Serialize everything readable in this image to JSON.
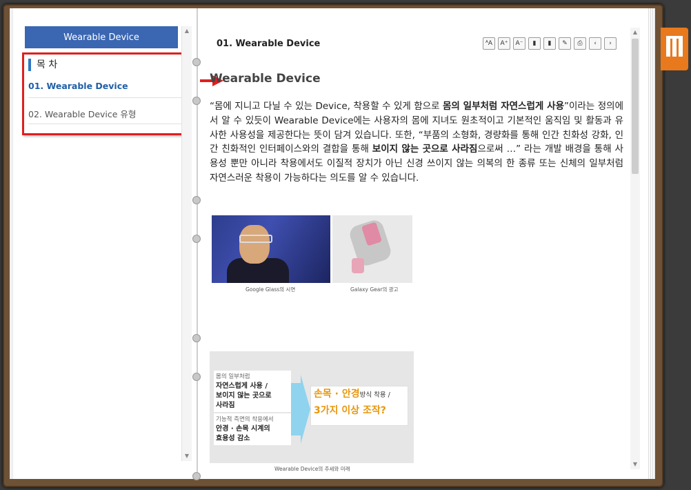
{
  "sidebar": {
    "header": "Wearable Device",
    "toc_title": "목 차",
    "items": [
      {
        "label": "01. Wearable Device"
      },
      {
        "label": "02. Wearable Device 유형"
      }
    ]
  },
  "content": {
    "chapter_title": "01. Wearable Device",
    "toolbar": [
      {
        "icon": "font-size-reset-icon",
        "glyph": "ᴬA"
      },
      {
        "icon": "font-size-increase-icon",
        "glyph": "A⁺"
      },
      {
        "icon": "font-size-decrease-icon",
        "glyph": "A⁻"
      },
      {
        "icon": "bookmark-icon",
        "glyph": "▮"
      },
      {
        "icon": "bookmark-list-icon",
        "glyph": "▮"
      },
      {
        "icon": "memo-icon",
        "glyph": "✎"
      },
      {
        "icon": "print-icon",
        "glyph": "⎙"
      },
      {
        "icon": "prev-page-icon",
        "glyph": "‹"
      },
      {
        "icon": "next-page-icon",
        "glyph": "›"
      }
    ],
    "heading": "Wearable Device",
    "paragraph": {
      "p1": "“몸에 지니고 다닐 수 있는 Device, 착용할 수 있게 함으로 ",
      "b1": "몸의 일부처럼 자연스럽게 사용",
      "p2": "”이라는 정의에서 알 수 있듯이 Wearable Device에는 사용자의 몸에 지녀도 원초적이고 기본적인 움직임 및 활동과 유사한 사용성을 제공한다는 뜻이 담겨 있습니다. 또한, “부품의 소형화, 경량화를 통해 인간 친화성 강화, 인간 친화적인 인터페이스와의 결합을 통해 ",
      "b2": "보이지 않는 곳으로 사라짐",
      "p3": "으로써 …” 라는 개발 배경을 통해 사용성 뿐만 아니라 착용에서도 이질적 장치가 아닌 신경 쓰이지 않는 의복의 한 종류 또는 신체의 일부처럼 자연스러운 착용이 가능하다는 의도를 알 수 있습니다."
    },
    "captions": {
      "img1": "Google Glass의 시연",
      "img2": "Galaxy Gear의 광고",
      "img3": "Wearable Device의 추세와 미래"
    },
    "diagram": {
      "box1_small": "몸의 일부처럼",
      "box1_line1": "자연스럽게 사용 /",
      "box1_line2": "보이지 않는 곳으로",
      "box1_line3": "사라짐",
      "box2_small": "기능적 측면의 착용에서",
      "box2_line1": "안경 · 손목 시계의",
      "box2_line2": "효용성 감소",
      "result_line1": "손목 · 안경",
      "result_line1_small": "방식 착용 /",
      "result_line2": "3가지 이상 조작?"
    }
  },
  "colors": {
    "header_blue": "#3a66b2",
    "highlight_red": "#e01e1e",
    "bookmark_orange": "#e8791d",
    "link_blue": "#1f5fa8",
    "result_orange": "#e8960a"
  }
}
